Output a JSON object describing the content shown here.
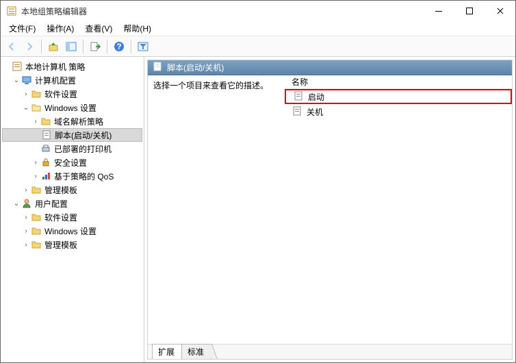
{
  "window": {
    "title": "本地组策略编辑器"
  },
  "menus": {
    "file": "文件(F)",
    "action": "操作(A)",
    "view": "查看(V)",
    "help": "帮助(H)"
  },
  "tree": {
    "root": "本地计算机 策略",
    "computer": "计算机配置",
    "software1": "软件设置",
    "windows1": "Windows 设置",
    "dns": "域名解析策略",
    "scripts": "脚本(启动/关机)",
    "printers": "已部署的打印机",
    "security": "安全设置",
    "qos": "基于策略的 QoS",
    "admin1": "管理模板",
    "user": "用户配置",
    "software2": "软件设置",
    "windows2": "Windows 设置",
    "admin2": "管理模板"
  },
  "detail": {
    "headerTitle": "脚本(启动/关机)",
    "descPrompt": "选择一个项目来查看它的描述。",
    "columnName": "名称",
    "rows": {
      "startup": "启动",
      "shutdown": "关机"
    },
    "tabs": {
      "extended": "扩展",
      "standard": "标准"
    }
  }
}
